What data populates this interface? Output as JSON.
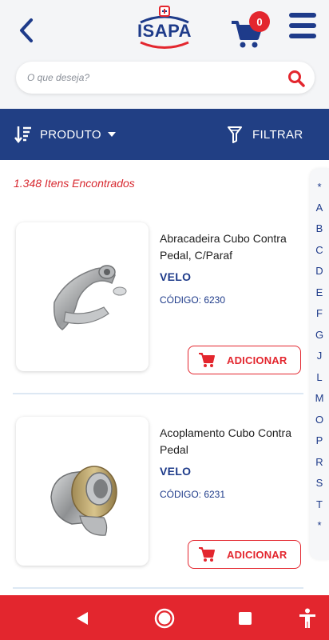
{
  "header": {
    "logo_text": "ISAPA",
    "cart_count": "0",
    "colors": {
      "brand_blue": "#1e3b8a",
      "brand_red": "#e3262e"
    }
  },
  "search": {
    "placeholder": "O que deseja?"
  },
  "toolbar": {
    "sort_label": "PRODUTO",
    "filter_label": "FILTRAR"
  },
  "results": {
    "count_text": "1.348 Itens Encontrados"
  },
  "alphabet": [
    "*",
    "A",
    "B",
    "C",
    "D",
    "E",
    "F",
    "G",
    "J",
    "L",
    "M",
    "O",
    "P",
    "R",
    "S",
    "T",
    "*"
  ],
  "products": [
    {
      "name": "Abracadeira Cubo Contra Pedal, C/Paraf",
      "brand": "VELO",
      "code": "CÓDIGO: 6230",
      "add_label": "ADICIONAR",
      "image_icon": "bicycle-clamp-photo"
    },
    {
      "name": "Acoplamento Cubo Contra Pedal",
      "brand": "VELO",
      "code": "CÓDIGO: 6231",
      "add_label": "ADICIONAR",
      "image_icon": "hub-coupling-photo"
    }
  ],
  "navbar": {
    "icons": [
      "back-triangle-icon",
      "home-circle-icon",
      "recents-square-icon",
      "accessibility-icon"
    ]
  }
}
